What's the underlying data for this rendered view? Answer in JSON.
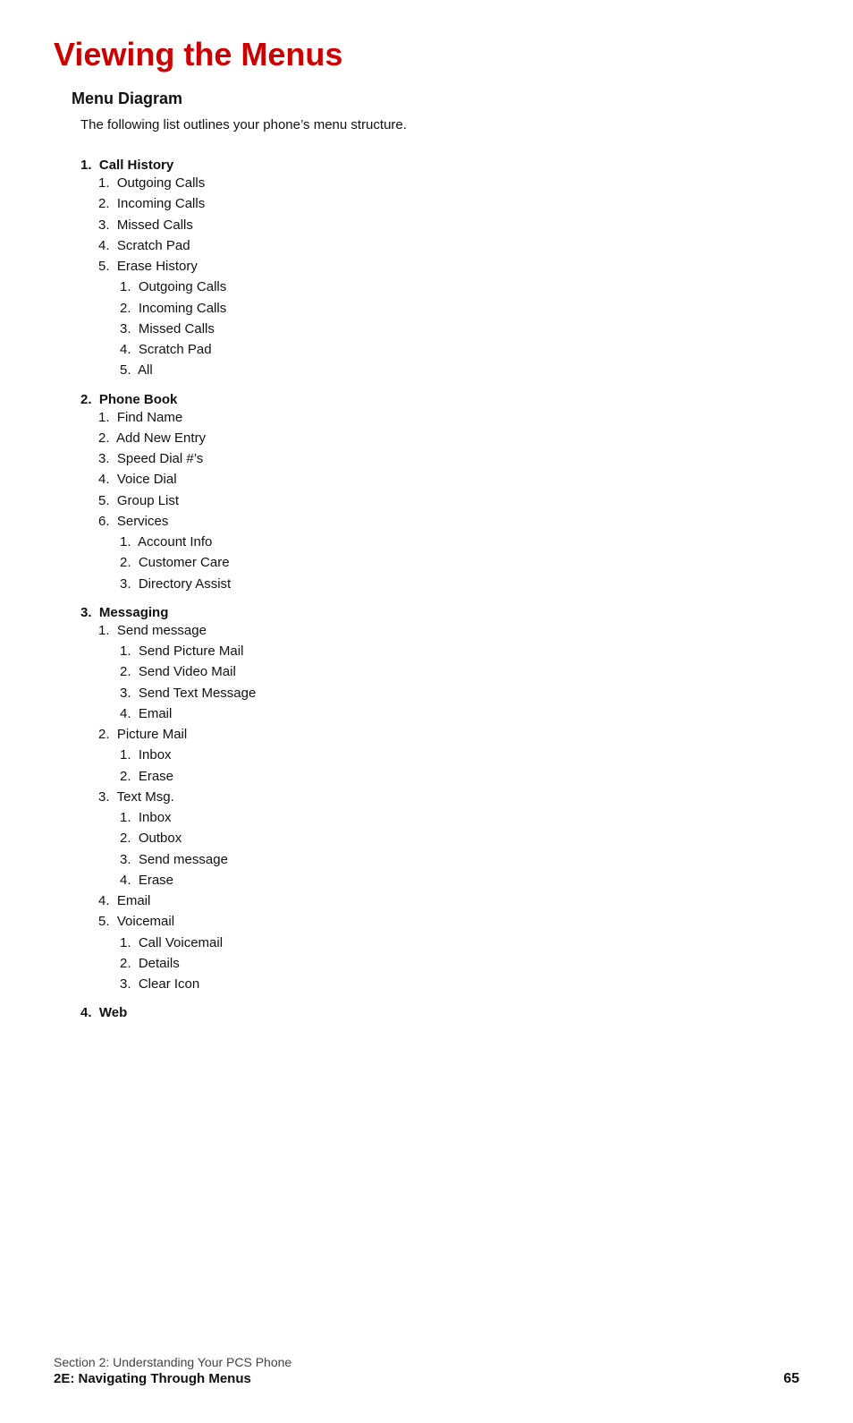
{
  "page": {
    "title": "Viewing the Menus",
    "section_heading": "Menu Diagram",
    "intro": "The following list outlines your phone’s menu structure.",
    "menu": [
      {
        "number": "1.",
        "label": "Call History",
        "items": [
          {
            "number": "1.",
            "text": "Outgoing Calls",
            "subitems": []
          },
          {
            "number": "2.",
            "text": "Incoming Calls",
            "subitems": []
          },
          {
            "number": "3.",
            "text": "Missed Calls",
            "subitems": []
          },
          {
            "number": "4.",
            "text": "Scratch Pad",
            "subitems": []
          },
          {
            "number": "5.",
            "text": "Erase History",
            "subitems": [
              {
                "number": "1.",
                "text": "Outgoing Calls"
              },
              {
                "number": "2.",
                "text": "Incoming Calls"
              },
              {
                "number": "3.",
                "text": "Missed Calls"
              },
              {
                "number": "4.",
                "text": "Scratch Pad"
              },
              {
                "number": "5.",
                "text": "All"
              }
            ]
          }
        ]
      },
      {
        "number": "2.",
        "label": "Phone Book",
        "items": [
          {
            "number": "1.",
            "text": "Find Name",
            "subitems": []
          },
          {
            "number": "2.",
            "text": "Add New Entry",
            "subitems": []
          },
          {
            "number": "3.",
            "text": "Speed Dial #’s",
            "subitems": []
          },
          {
            "number": "4.",
            "text": "Voice Dial",
            "subitems": []
          },
          {
            "number": "5.",
            "text": "Group List",
            "subitems": []
          },
          {
            "number": "6.",
            "text": "Services",
            "subitems": [
              {
                "number": "1.",
                "text": "Account Info"
              },
              {
                "number": "2.",
                "text": "Customer Care"
              },
              {
                "number": "3.",
                "text": "Directory Assist"
              }
            ]
          }
        ]
      },
      {
        "number": "3.",
        "label": "Messaging",
        "items": [
          {
            "number": "1.",
            "text": "Send message",
            "subitems": [
              {
                "number": "1.",
                "text": "Send Picture Mail"
              },
              {
                "number": "2.",
                "text": "Send Video Mail"
              },
              {
                "number": "3.",
                "text": "Send Text Message"
              },
              {
                "number": "4.",
                "text": "Email"
              }
            ]
          },
          {
            "number": "2.",
            "text": "Picture Mail",
            "subitems": [
              {
                "number": "1.",
                "text": "Inbox"
              },
              {
                "number": "2.",
                "text": "Erase"
              }
            ]
          },
          {
            "number": "3.",
            "text": "Text Msg.",
            "subitems": [
              {
                "number": "1.",
                "text": "Inbox"
              },
              {
                "number": "2.",
                "text": "Outbox"
              },
              {
                "number": "3.",
                "text": "Send message"
              },
              {
                "number": "4.",
                "text": "Erase"
              }
            ]
          },
          {
            "number": "4.",
            "text": "Email",
            "subitems": []
          },
          {
            "number": "5.",
            "text": "Voicemail",
            "subitems": [
              {
                "number": "1.",
                "text": "Call Voicemail"
              },
              {
                "number": "2.",
                "text": "Details"
              },
              {
                "number": "3.",
                "text": "Clear Icon"
              }
            ]
          }
        ]
      },
      {
        "number": "4.",
        "label": "Web",
        "items": []
      }
    ],
    "footer": {
      "section": "Section 2: Understanding Your PCS Phone",
      "nav_label": "2E: Navigating Through Menus",
      "page_number": "65"
    }
  }
}
